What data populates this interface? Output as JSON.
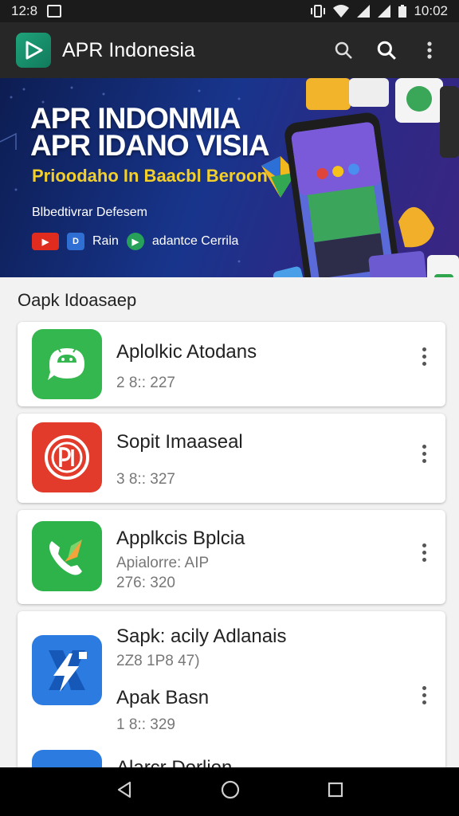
{
  "status": {
    "time_left": "12:8",
    "clock": "10:02"
  },
  "app_bar": {
    "title": "APR Indonesia"
  },
  "banner": {
    "title_line1": "APR INDONMIA",
    "title_line2": "APR IDANO VISIA",
    "subtitle": "Prioodaho In Baacbl Beroon",
    "small_text": "Blbedtivrar Defesem",
    "link1": "Rain",
    "link2": "adantce Cerrila"
  },
  "section": {
    "title": "Oapk Idoasaep"
  },
  "apps": [
    {
      "name": "Aplolkic Atodans",
      "meta": "2 8:: 227"
    },
    {
      "name": "Sopit Imaaseal",
      "meta": "3 8:: 327"
    },
    {
      "name": "Applkcis Bplcia",
      "meta1": "Apialorre: AIP",
      "meta2": "276: 320"
    },
    {
      "name": "Sapk: acily Adlanais",
      "meta1": "2Z8 1P8 47)",
      "name2": "Apak Basn",
      "meta2": "1 8:: 329"
    },
    {
      "name": "Alarcr Dorlion"
    }
  ]
}
